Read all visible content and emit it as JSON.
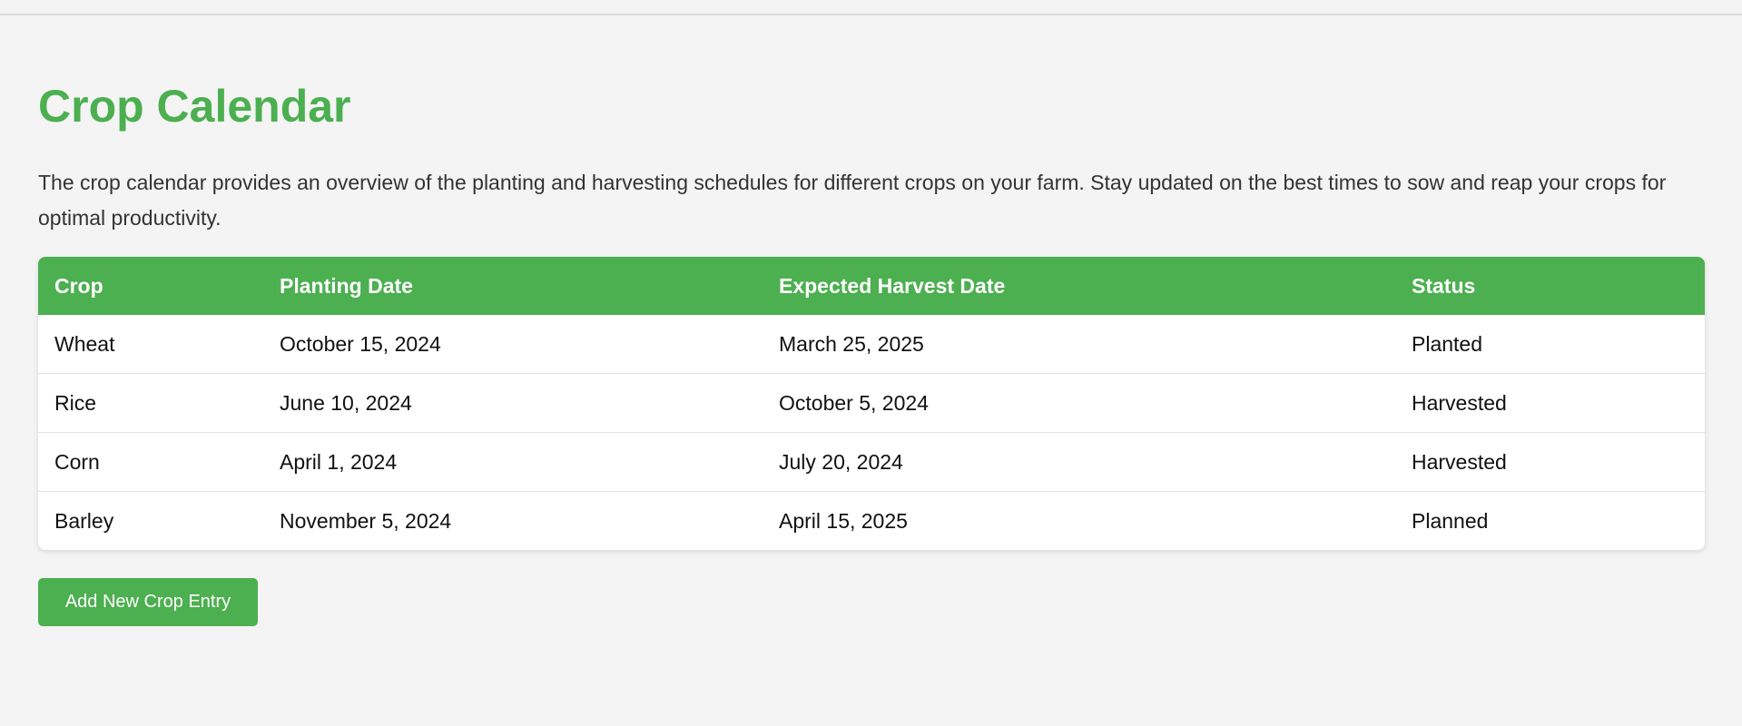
{
  "page": {
    "title": "Crop Calendar",
    "description": "The crop calendar provides an overview of the planting and harvesting schedules for different crops on your farm. Stay updated on the best times to sow and reap your crops for optimal productivity."
  },
  "table": {
    "headers": [
      "Crop",
      "Planting Date",
      "Expected Harvest Date",
      "Status"
    ],
    "rows": [
      [
        "Wheat",
        "October 15, 2024",
        "March 25, 2025",
        "Planted"
      ],
      [
        "Rice",
        "June 10, 2024",
        "October 5, 2024",
        "Harvested"
      ],
      [
        "Corn",
        "April 1, 2024",
        "July 20, 2024",
        "Harvested"
      ],
      [
        "Barley",
        "November 5, 2024",
        "April 15, 2025",
        "Planned"
      ]
    ]
  },
  "actions": {
    "add_label": "Add New Crop Entry"
  },
  "colors": {
    "accent": "#4caf50",
    "background": "#f4f4f4",
    "text": "#333333"
  }
}
